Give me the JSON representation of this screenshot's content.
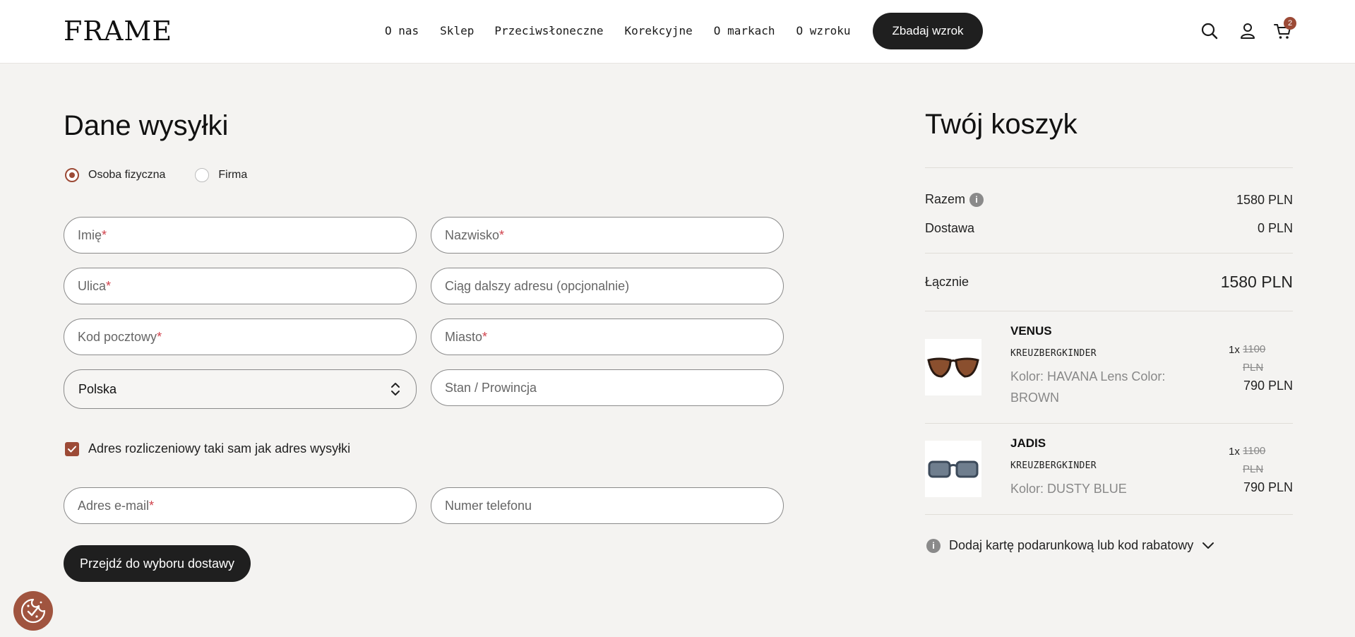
{
  "header": {
    "logo": "FRAME",
    "nav": [
      "O nas",
      "Sklep",
      "Przeciwsłoneczne",
      "Korekcyjne",
      "O markach",
      "O wzroku"
    ],
    "cta": "Zbadaj wzrok",
    "cart_count": "2",
    "icons": [
      "search-icon",
      "user-icon",
      "cart-icon"
    ]
  },
  "shipping": {
    "title": "Dane wysyłki",
    "customer_types": [
      "Osoba fizyczna",
      "Firma"
    ],
    "selected_type": "Osoba fizyczna",
    "fields": {
      "first_name": "Imię",
      "last_name": "Nazwisko",
      "street": "Ulica",
      "address2": "Ciąg dalszy adresu (opcjonalnie)",
      "postal": "Kod pocztowy",
      "city": "Miasto",
      "country": "Polska",
      "state": "Stan / Prowincja",
      "email": "Adres e-mail",
      "phone": "Numer telefonu"
    },
    "required_mark": "*",
    "billing_same": "Adres rozliczeniowy taki sam jak adres wysyłki",
    "submit": "Przejdź do wyboru dostawy"
  },
  "cart": {
    "title": "Twój koszyk",
    "subtotal_label": "Razem",
    "subtotal": "1580 PLN",
    "shipping_label": "Dostawa",
    "shipping": "0 PLN",
    "total_label": "Łącznie",
    "total": "1580 PLN",
    "items": [
      {
        "name": "VENUS",
        "brand": "KREUZBERGKINDER",
        "color": "Kolor: HAVANA Lens Color: BROWN",
        "qty": "1x",
        "old_price_num": "1100",
        "old_price_cur": "PLN",
        "price": "790 PLN"
      },
      {
        "name": "JADIS",
        "brand": "KREUZBERGKINDER",
        "color": "Kolor: DUSTY BLUE",
        "qty": "1x",
        "old_price_num": "1100",
        "old_price_cur": "PLN",
        "price": "790 PLN"
      }
    ],
    "gift": "Dodaj kartę podarunkową lub kod rabatowy"
  },
  "colors": {
    "accent": "#9c4a36",
    "dark_button": "#1f1f1f",
    "background": "#f4f3f1",
    "required": "#d0414b"
  }
}
